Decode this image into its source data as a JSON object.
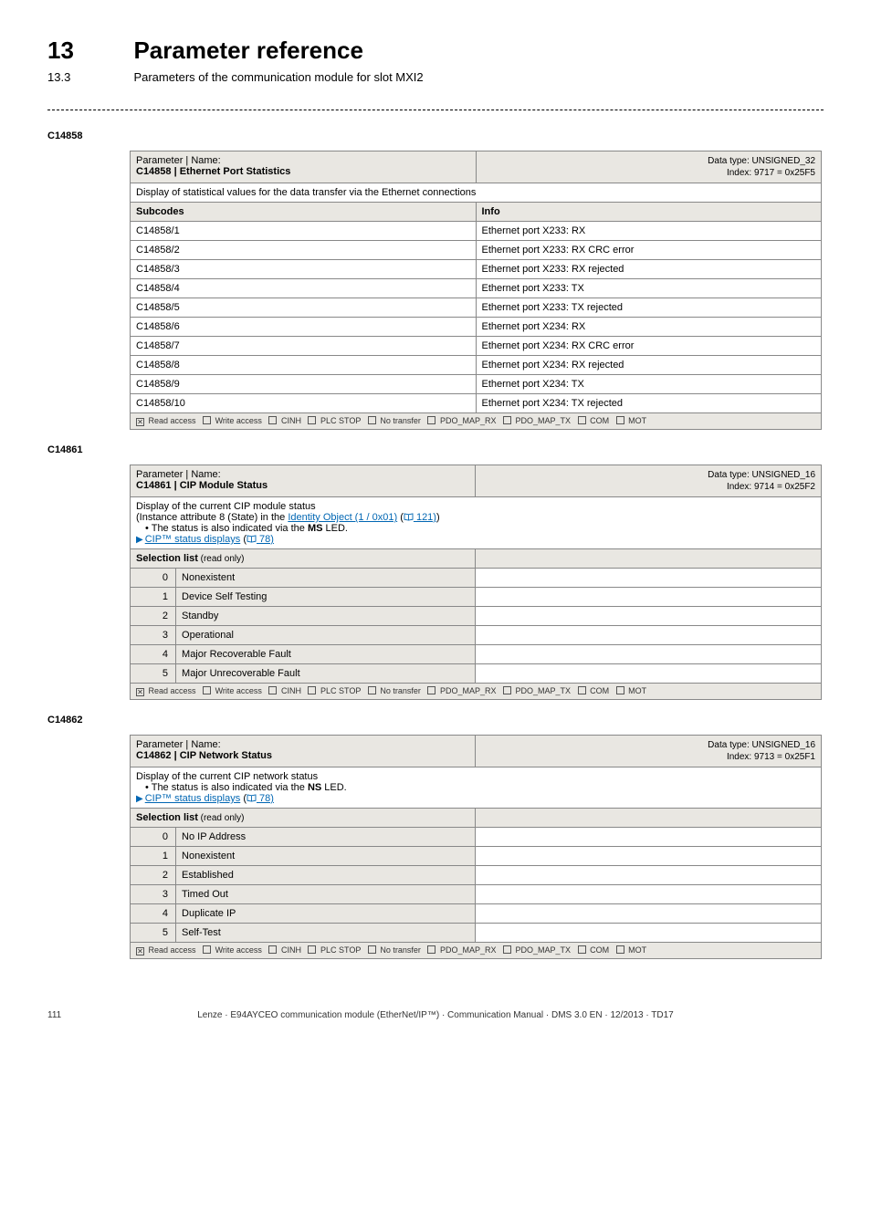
{
  "header": {
    "chapter_number": "13",
    "chapter_title": "Parameter reference",
    "section_number": "13.3",
    "section_title": "Parameters of the communication module for slot MXI2"
  },
  "param1": {
    "code": "C14858",
    "hdr_prefix": "Parameter | Name:",
    "hdr_name": "C14858 | Ethernet Port Statistics",
    "hdr_type_line1": "Data type: UNSIGNED_32",
    "hdr_type_line2": "Index: 9717 = 0x25F5",
    "desc": "Display of statistical values for the data transfer via the Ethernet connections",
    "col1": "Subcodes",
    "col2": "Info",
    "rows": [
      {
        "sub": "C14858/1",
        "info": "Ethernet port X233: RX"
      },
      {
        "sub": "C14858/2",
        "info": "Ethernet port X233: RX CRC error"
      },
      {
        "sub": "C14858/3",
        "info": "Ethernet port X233: RX rejected"
      },
      {
        "sub": "C14858/4",
        "info": "Ethernet port X233: TX"
      },
      {
        "sub": "C14858/5",
        "info": "Ethernet port X233: TX rejected"
      },
      {
        "sub": "C14858/6",
        "info": "Ethernet port X234: RX"
      },
      {
        "sub": "C14858/7",
        "info": "Ethernet port X234: RX CRC error"
      },
      {
        "sub": "C14858/8",
        "info": "Ethernet port X234: RX rejected"
      },
      {
        "sub": "C14858/9",
        "info": "Ethernet port X234: TX"
      },
      {
        "sub": "C14858/10",
        "info": "Ethernet port X234: TX rejected"
      }
    ]
  },
  "param2": {
    "code": "C14861",
    "hdr_prefix": "Parameter | Name:",
    "hdr_name": "C14861 | CIP Module Status",
    "hdr_type_line1": "Data type: UNSIGNED_16",
    "hdr_type_line2": "Index: 9714 = 0x25F2",
    "desc_line1": "Display of the current CIP module status",
    "desc_line2a": "(Instance attribute 8 (State) in the ",
    "desc_line2_link": "Identity Object (1 / 0x01)",
    "desc_line2_ref": " 121)",
    "desc_line2b": ")",
    "desc_line3a": "The status is also indicated via the ",
    "desc_line3b": "MS",
    "desc_line3c": " LED.",
    "desc_line4_link": "CIP™ status displays",
    "desc_line4_ref": " 78)",
    "sel_hdr": "Selection list",
    "sel_hdr_sub": " (read only)",
    "rows": [
      {
        "n": "0",
        "label": "Nonexistent"
      },
      {
        "n": "1",
        "label": "Device Self Testing"
      },
      {
        "n": "2",
        "label": "Standby"
      },
      {
        "n": "3",
        "label": "Operational"
      },
      {
        "n": "4",
        "label": "Major Recoverable Fault"
      },
      {
        "n": "5",
        "label": "Major Unrecoverable Fault"
      }
    ]
  },
  "param3": {
    "code": "C14862",
    "hdr_prefix": "Parameter | Name:",
    "hdr_name": "C14862 | CIP Network Status",
    "hdr_type_line1": "Data type: UNSIGNED_16",
    "hdr_type_line2": "Index: 9713 = 0x25F1",
    "desc_line1": "Display of the current CIP network status",
    "desc_line2a": "The status is also indicated via the ",
    "desc_line2b": "NS",
    "desc_line2c": " LED.",
    "desc_line3_link": "CIP™ status displays",
    "desc_line3_ref": " 78)",
    "sel_hdr": "Selection list",
    "sel_hdr_sub": " (read only)",
    "rows": [
      {
        "n": "0",
        "label": "No IP Address"
      },
      {
        "n": "1",
        "label": "Nonexistent"
      },
      {
        "n": "2",
        "label": "Established"
      },
      {
        "n": "3",
        "label": "Timed Out"
      },
      {
        "n": "4",
        "label": "Duplicate IP"
      },
      {
        "n": "5",
        "label": "Self-Test"
      }
    ]
  },
  "access_labels": {
    "read": "Read access",
    "write": "Write access",
    "cinh": "CINH",
    "plcstop": "PLC STOP",
    "notransfer": "No transfer",
    "pdo_rx": "PDO_MAP_RX",
    "pdo_tx": "PDO_MAP_TX",
    "com": "COM",
    "mot": "MOT"
  },
  "footer": {
    "page": "111",
    "text": "Lenze · E94AYCEO communication module (EtherNet/IP™) · Communication Manual · DMS 3.0 EN · 12/2013 · TD17"
  }
}
